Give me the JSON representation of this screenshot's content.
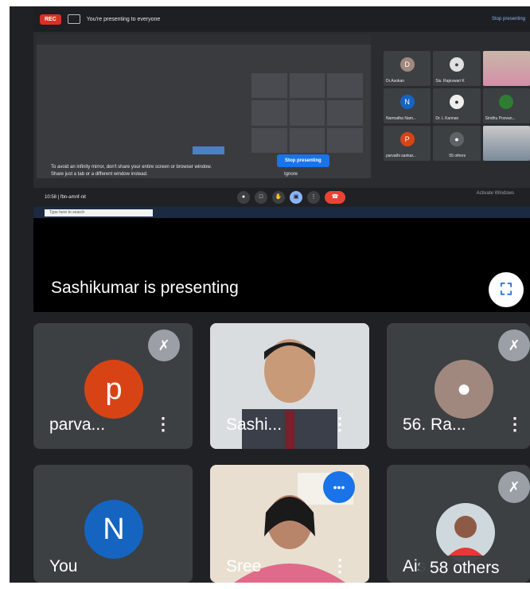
{
  "banner": {
    "rec_label": "REC",
    "presenting_text": "You're presenting to everyone",
    "stop_label": "Stop presenting"
  },
  "mirror": {
    "message_line1": "To avoid an infinity mirror, don't share your entire screen or browser window.",
    "message_line2": "Share just a tab or a different window instead.",
    "stop_button": "Stop presenting",
    "ignore_button": "Ignore"
  },
  "mini_tiles": [
    {
      "name": "Dr.Asokan",
      "initial": "D",
      "color": "#a1887f"
    },
    {
      "name": "Sis. Rajeswari K",
      "initial": "",
      "color": "#ffffff"
    },
    {
      "name": "",
      "initial": "",
      "color": ""
    },
    {
      "name": "Narmatha Nam...",
      "initial": "N",
      "color": "#1565c0"
    },
    {
      "name": "Dr. L Kannan",
      "initial": "",
      "color": "#ffffff"
    },
    {
      "name": "Sindhu Poovan...",
      "initial": "",
      "color": "#2e7d32"
    },
    {
      "name": "parvathi sankar...",
      "initial": "P",
      "color": "#d84315"
    },
    {
      "name": "55 others",
      "initial": "",
      "color": ""
    },
    {
      "name": "",
      "initial": "",
      "color": ""
    }
  ],
  "controls": {
    "meeting_info": "10:58 | fbn-amnf-nit",
    "activate_windows": "Activate Windows"
  },
  "taskbar": {
    "search_placeholder": "Type here to search"
  },
  "presenting": {
    "text": "Sashikumar is presenting"
  },
  "participants": [
    {
      "name": "parva...",
      "initial": "p",
      "avatar_color": "#d84315",
      "muted": true
    },
    {
      "name": "Sashi...",
      "video": true,
      "muted": false
    },
    {
      "name": "56. Ra...",
      "avatar_color": "#a1887f",
      "muted": true
    },
    {
      "name": "You",
      "initial": "N",
      "avatar_color": "#1565c0",
      "muted": false
    },
    {
      "name": "Sree",
      "video": true,
      "speaking": true
    },
    {
      "name": "Ais",
      "photo": true,
      "muted": true
    }
  ],
  "others_label": "58 others",
  "colors": {
    "background": "#202124",
    "tile": "#3c4043",
    "accent_blue": "#1a73e8",
    "end_call": "#ea4335"
  }
}
